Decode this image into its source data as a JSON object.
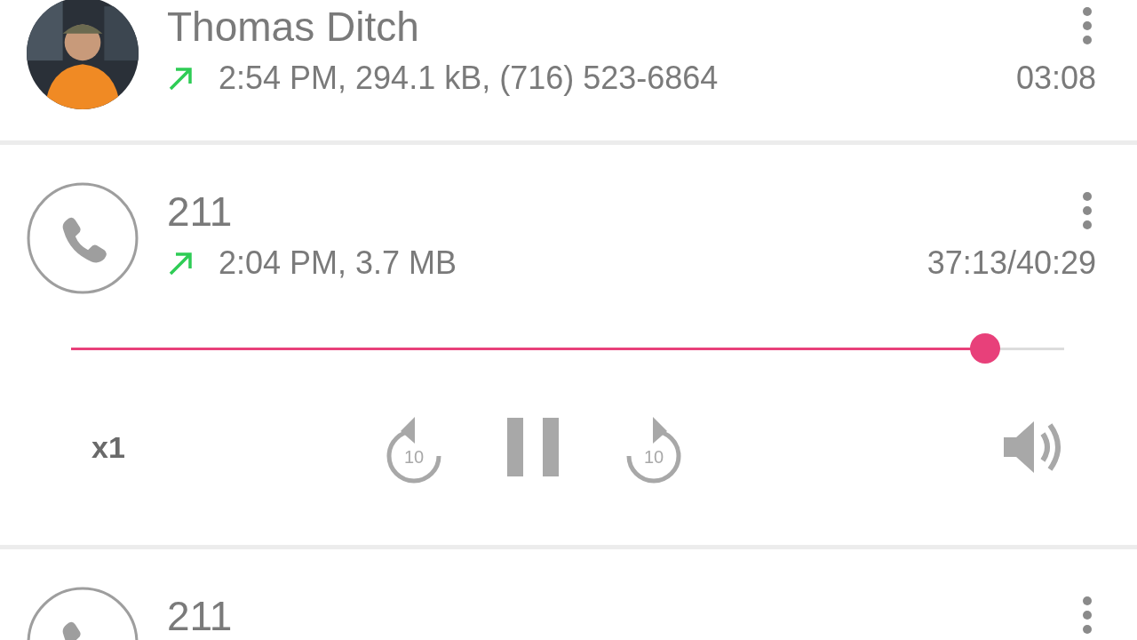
{
  "recordings": [
    {
      "name": "Thomas Ditch",
      "direction": {
        "kind": "outgoing"
      },
      "details": "2:54 PM, 294.1 kB, (716) 523-6864",
      "duration": "03:08"
    },
    {
      "avatar": {
        "kind": "phone"
      },
      "name": "211",
      "direction": {
        "kind": "outgoing"
      },
      "details": "2:04 PM, 3.7 MB",
      "duration": "37:13/40:29",
      "player": {
        "level": 0.92,
        "speed": "x1",
        "rewind_label": "10",
        "playing": true,
        "forward_label": "10"
      }
    },
    {
      "avatar": {
        "kind": "phone"
      },
      "name": "211"
    }
  ]
}
